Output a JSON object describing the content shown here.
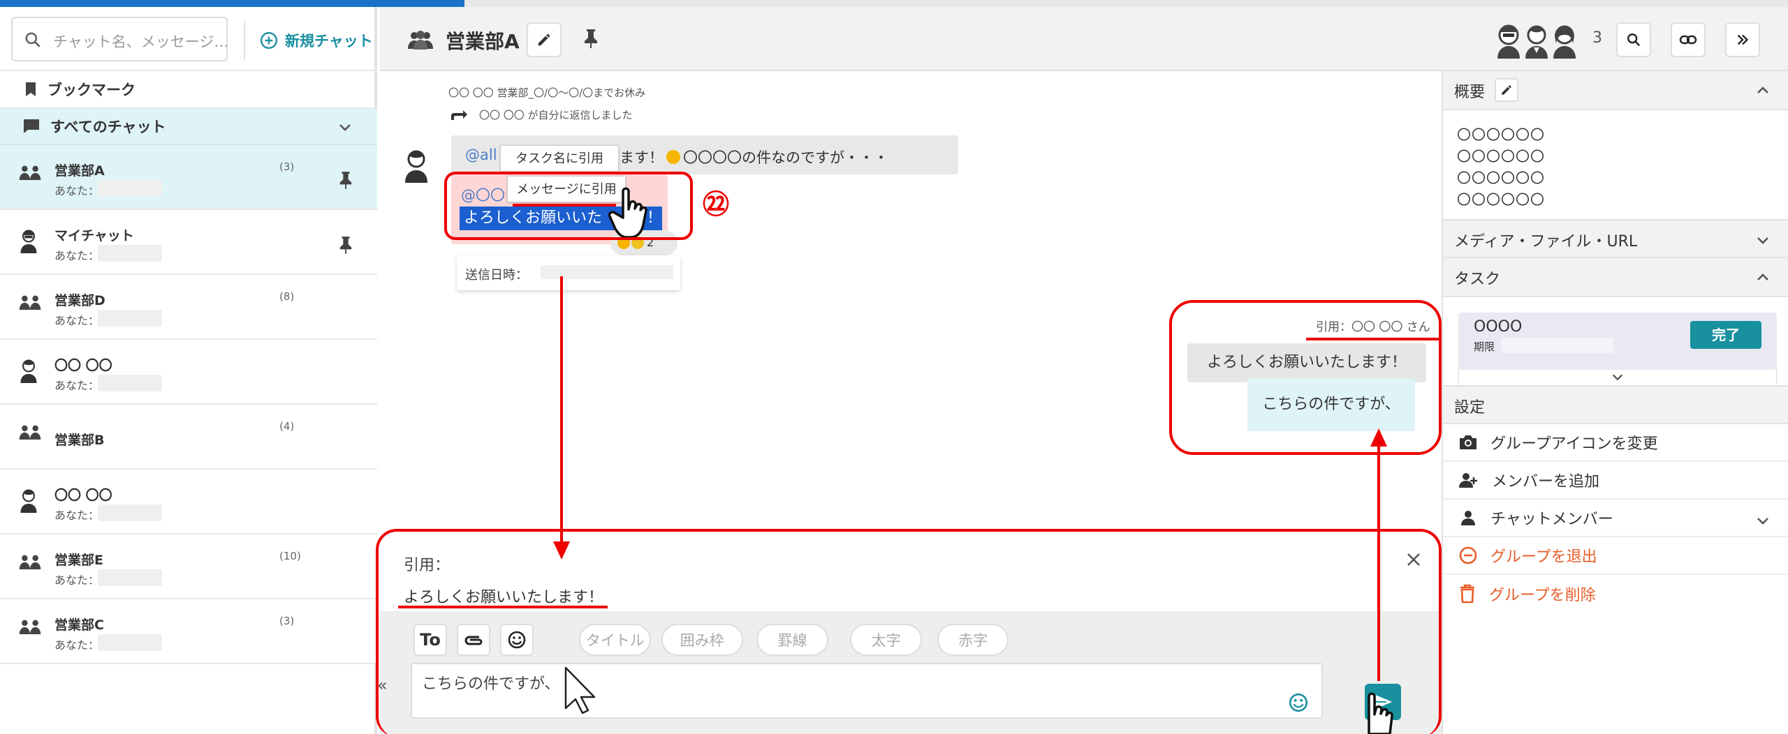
{
  "sidebar": {
    "search_placeholder": "チャット名、メッセージ…",
    "new_chat_label": "新規チャット",
    "bookmark_label": "ブックマーク",
    "all_chats_label": "すべてのチャット",
    "you_label": "あなた：",
    "items": [
      {
        "name": "営業部A",
        "count": "(3)",
        "sub": "あなた：",
        "icon": "group-icon",
        "pinned": true,
        "active": true
      },
      {
        "name": "マイチャット",
        "count": "",
        "sub": "あなた：:",
        "icon": "man-avatar-icon",
        "pinned": true,
        "active": false
      },
      {
        "name": "営業部D",
        "count": "(8)",
        "sub": "あなた：:",
        "icon": "group-icon",
        "pinned": false,
        "active": false
      },
      {
        "name": "〇〇 〇〇",
        "count": "",
        "sub": "あなた：:",
        "icon": "woman-avatar-icon",
        "pinned": false,
        "active": false
      },
      {
        "name": "営業部B",
        "count": "(4)",
        "sub": "",
        "icon": "group-icon",
        "pinned": false,
        "active": false
      },
      {
        "name": "〇〇 〇〇",
        "count": "",
        "sub": "あなた：",
        "icon": "woman-avatar-icon",
        "pinned": false,
        "active": false
      },
      {
        "name": "営業部E",
        "count": "(10)",
        "sub": "あなた：",
        "icon": "group-icon",
        "pinned": false,
        "active": false
      },
      {
        "name": "営業部C",
        "count": "(3)",
        "sub": "あなた：",
        "icon": "group-icon",
        "pinned": false,
        "active": false
      }
    ]
  },
  "header": {
    "title": "営業部A",
    "member_count": "3"
  },
  "messages": {
    "meta_status": "〇〇 〇〇  営業部_〇/〇～〇/〇までお休み",
    "meta_reply": "〇〇 〇〇 が自分に返信しました",
    "msg1_to": "@all",
    "msg1_text": "します！",
    "msg1_text_tail": "〇〇〇〇の件なのですが・・・",
    "tooltip_task": "タスク名に引用",
    "tooltip_quote": "メッセージに引用",
    "msg2_to": "@〇〇",
    "msg2_selected": "よろしくお願いいた",
    "msg2_selected_tail": "！",
    "reaction_count": "2",
    "sent_time_label": "送信日時：",
    "annotation_number": "㉒",
    "my_quote_header": "引用：〇〇 〇〇 さん",
    "my_quote_text": "よろしくお願いいたします！",
    "my_message": "こちらの件ですが、"
  },
  "composer": {
    "quote_label": "引用：",
    "quote_text": "よろしくお願いいたします！",
    "to_label": "To",
    "pills": [
      "タイトル",
      "囲み枠",
      "罫線",
      "太字",
      "赤字"
    ],
    "input_value": "こちらの件ですが、",
    "collapse_label": "«"
  },
  "right_panel": {
    "overview_label": "概要",
    "overview_lines": [
      "〇〇〇〇〇〇",
      "〇〇〇〇〇〇",
      "〇〇〇〇〇〇",
      "〇〇〇〇〇〇"
    ],
    "media_label": "メディア・ファイル・URL",
    "task_label": "タスク",
    "task_title": "OOOO",
    "task_deadline_label": "期限",
    "task_done_label": "完了",
    "settings_label": "設定",
    "change_icon_label": "グループアイコンを変更",
    "add_member_label": "メンバーを追加",
    "chat_members_label": "チャットメンバー",
    "leave_group_label": "グループを退出",
    "delete_group_label": "グループを削除"
  },
  "colors": {
    "accent": "#18909e",
    "active_bg": "#dff4f7",
    "annotation_red": "#e00000",
    "danger": "#e85d2a",
    "mention": "#4a7ec8",
    "selection": "#1b5fd0"
  }
}
